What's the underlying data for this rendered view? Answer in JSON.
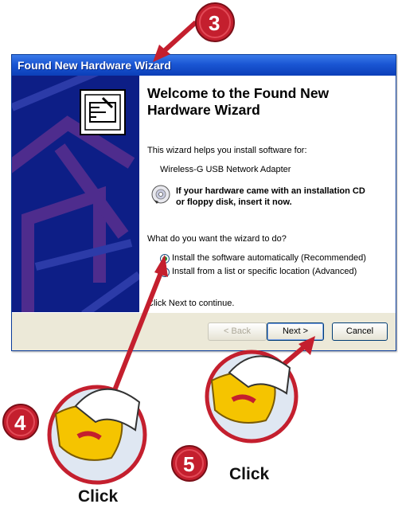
{
  "window": {
    "title": "Found New Hardware Wizard",
    "heading": "Welcome to the Found New Hardware Wizard",
    "intro": "This wizard helps you install software for:",
    "device": "Wireless-G USB Network Adapter",
    "cd_note_line1": "If your hardware came with an installation CD",
    "cd_note_line2": "or floppy disk, insert it now.",
    "question": "What do you want the wizard to do?",
    "options": [
      {
        "label": "Install the software automatically (Recommended)",
        "selected": true
      },
      {
        "label": "Install from a list or specific location (Advanced)",
        "selected": false
      }
    ],
    "continue_text": "Click Next to continue.",
    "buttons": {
      "back": "< Back",
      "next": "Next >",
      "cancel": "Cancel"
    }
  },
  "callouts": {
    "step3": "3",
    "step4": "4",
    "step5": "5",
    "click_left": "Click",
    "click_right": "Click"
  },
  "colors": {
    "accent_red": "#c41f2e",
    "title_blue": "#1a56d4",
    "wizard_panel": "#0d1e86"
  },
  "icons": [
    "hardware-icon",
    "cd-icon",
    "mouse-hand-icon",
    "arrow-icon"
  ]
}
